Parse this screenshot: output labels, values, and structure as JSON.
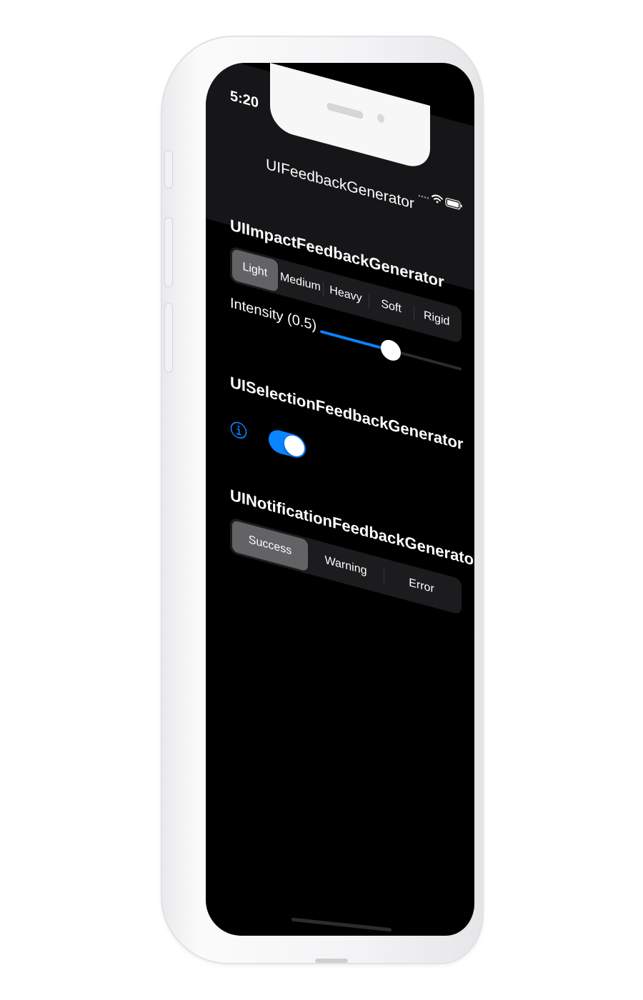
{
  "status_bar": {
    "time": "5:20"
  },
  "nav": {
    "title": "UIFeedbackGenerator"
  },
  "impact": {
    "title": "UIImpactFeedbackGenerator",
    "options": [
      "Light",
      "Medium",
      "Heavy",
      "Soft",
      "Rigid"
    ],
    "selected": "Light",
    "intensity_label": "Intensity (0.5)",
    "intensity_value": 0.5
  },
  "selection": {
    "title": "UISelectionFeedbackGenerator",
    "toggle_on": true
  },
  "notification": {
    "title": "UINotificationFeedbackGenerator",
    "options": [
      "Success",
      "Warning",
      "Error"
    ],
    "selected": "Success"
  },
  "icons": {
    "info": "info-circle-icon",
    "wifi": "wifi-icon",
    "battery": "battery-icon",
    "signal": "cellular-signal-icon"
  },
  "colors": {
    "accent": "#0a84ff",
    "background": "#000000",
    "nav_background": "#161618",
    "segment_background": "#1c1c1e",
    "segment_selected": "#636366"
  }
}
